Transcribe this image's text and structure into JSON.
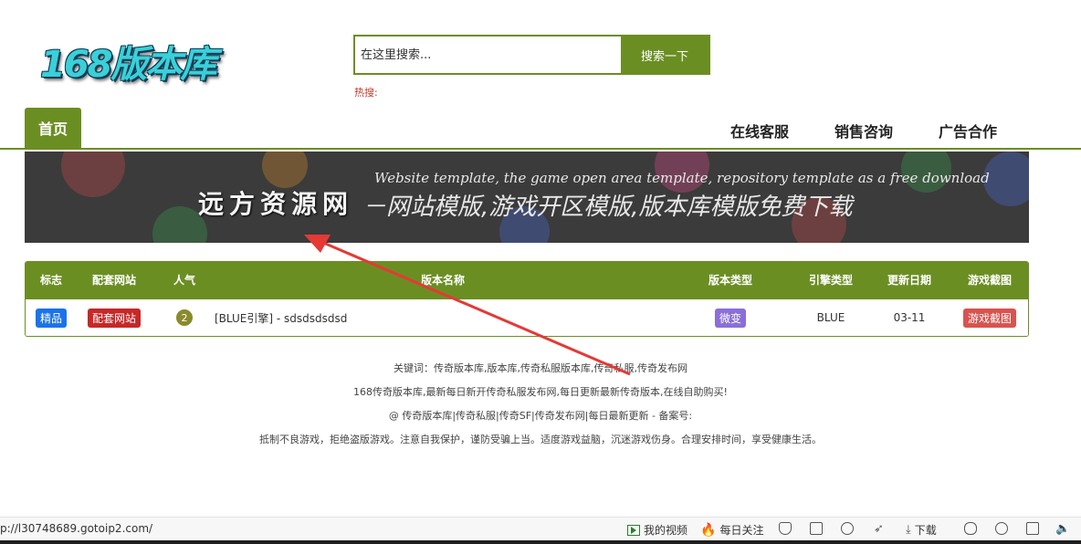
{
  "header": {
    "logo_text": "168版本库",
    "search_placeholder": "在这里搜索...",
    "search_button": "搜索一下",
    "hot_label": "热搜:"
  },
  "nav": {
    "home": "首页",
    "items": [
      "在线客服",
      "销售咨询",
      "广告合作"
    ]
  },
  "banner": {
    "english": "Website template, the game open area template, repository template as a free download",
    "title": "远方资源网",
    "subtitle": "－网站模版,游戏开区模版,版本库模版免费下载"
  },
  "table": {
    "headers": [
      "标志",
      "配套网站",
      "人气",
      "版本名称",
      "版本类型",
      "引擎类型",
      "更新日期",
      "游戏截图"
    ],
    "rows": [
      {
        "flag": "精品",
        "site": "配套网站",
        "popularity": "2",
        "name": "[BLUE引擎] - sdsdsdsdsd",
        "type": "微变",
        "engine": "BLUE",
        "date": "03-11",
        "screenshot": "游戏截图"
      }
    ]
  },
  "footer": {
    "keywords": "关键词：传奇版本库,版本库,传奇私服版本库,传奇私服,传奇发布网",
    "description": "168传奇版本库,最新每日新开传奇私服发布网,每日更新最新传奇版本,在线自助购买!",
    "copyright": "@ 传奇版本库|传奇私服|传奇SF|传奇发布网|每日最新更新 - 备案号:",
    "notice": "抵制不良游戏，拒绝盗版游戏。注意自我保护，谨防受骗上当。适度游戏益脑，沉迷游戏伤身。合理安排时间，享受健康生活。"
  },
  "statusbar": {
    "url": "p://l30748689.gotoip2.com/",
    "my_video": "我的视频",
    "daily_follow": "每日关注",
    "download": "下载"
  },
  "colors": {
    "accent": "#6b8e23",
    "banner_bg": "#3b3b3b",
    "arrow": "#e53935"
  }
}
